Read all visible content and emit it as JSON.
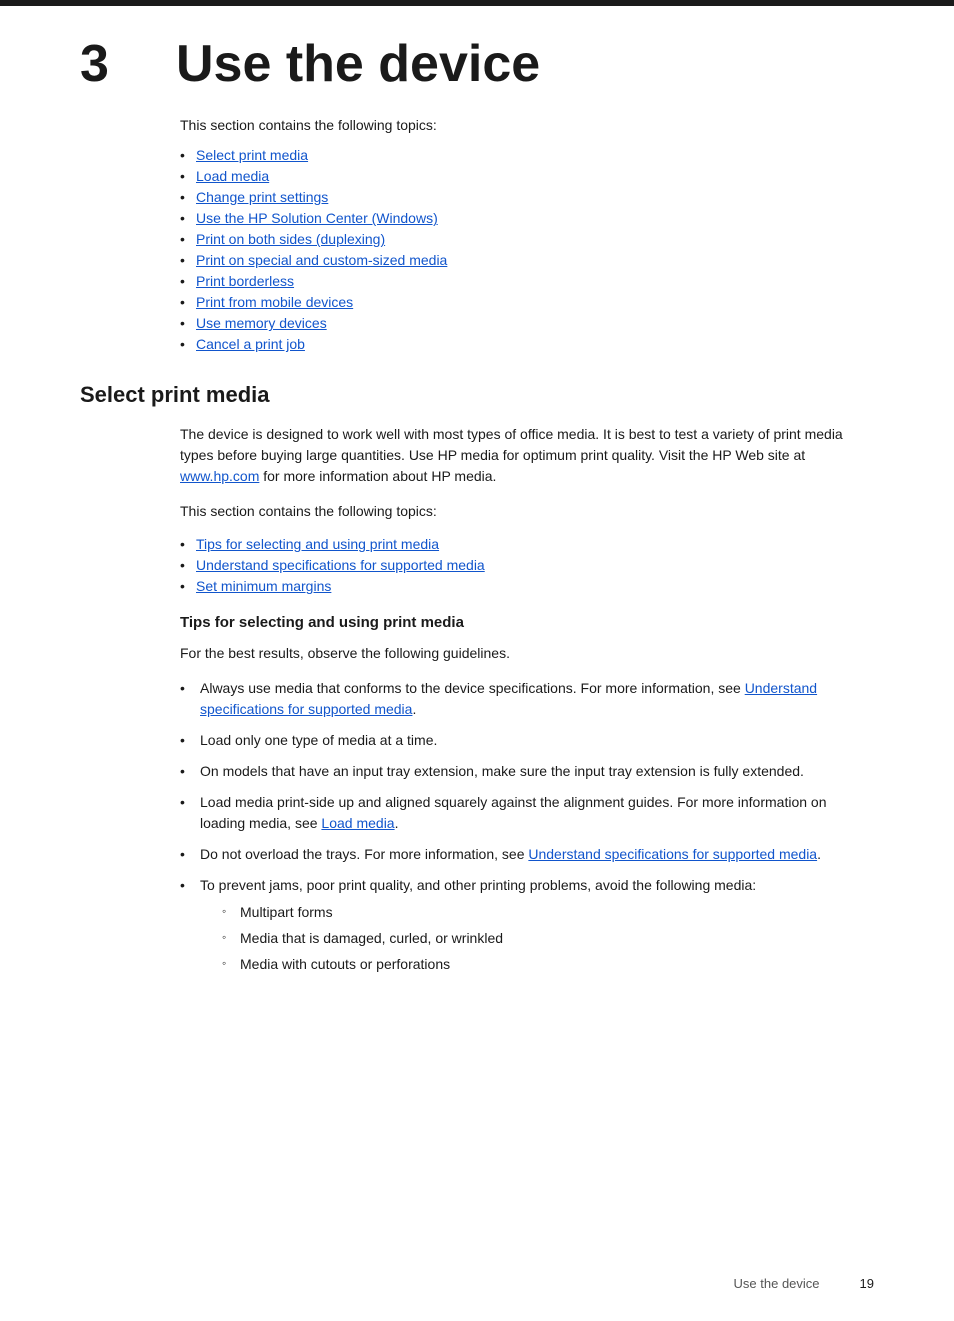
{
  "page": {
    "top_border": true,
    "chapter": {
      "number": "3",
      "title": "Use the device"
    },
    "intro": "This section contains the following topics:",
    "toc_items": [
      {
        "label": "Select print media",
        "href": "#select-print-media"
      },
      {
        "label": "Load media",
        "href": "#load-media"
      },
      {
        "label": "Change print settings",
        "href": "#change-print-settings"
      },
      {
        "label": "Use the HP Solution Center (Windows)",
        "href": "#hp-solution-center"
      },
      {
        "label": "Print on both sides (duplexing)",
        "href": "#duplexing"
      },
      {
        "label": "Print on special and custom-sized media",
        "href": "#special-media"
      },
      {
        "label": "Print borderless",
        "href": "#borderless"
      },
      {
        "label": "Print from mobile devices",
        "href": "#mobile-devices"
      },
      {
        "label": "Use memory devices",
        "href": "#memory-devices"
      },
      {
        "label": "Cancel a print job",
        "href": "#cancel-print"
      }
    ],
    "sections": [
      {
        "id": "select-print-media",
        "title": "Select print media",
        "body": "The device is designed to work well with most types of office media. It is best to test a variety of print media types before buying large quantities. Use HP media for optimum print quality. Visit the HP Web site at ",
        "body_link_text": "www.hp.com",
        "body_link_href": "http://www.hp.com",
        "body_suffix": " for more information about HP media.",
        "subsection_intro": "This section contains the following topics:",
        "sub_toc_items": [
          {
            "label": "Tips for selecting and using print media",
            "href": "#tips"
          },
          {
            "label": "Understand specifications for supported media",
            "href": "#specs"
          },
          {
            "label": "Set minimum margins",
            "href": "#margins"
          }
        ],
        "subsections": [
          {
            "id": "tips",
            "title": "Tips for selecting and using print media",
            "intro": "For the best results, observe the following guidelines.",
            "bullets": [
              {
                "text": "Always use media that conforms to the device specifications. For more information, see ",
                "link_text": "Understand specifications for supported media",
                "link_href": "#specs",
                "text_suffix": ".",
                "sub_bullets": []
              },
              {
                "text": "Load only one type of media at a time.",
                "sub_bullets": []
              },
              {
                "text": "On models that have an input tray extension, make sure the input tray extension is fully extended.",
                "sub_bullets": []
              },
              {
                "text": "Load media print-side up and aligned squarely against the alignment guides. For more information on loading media, see ",
                "link_text": "Load media",
                "link_href": "#load-media",
                "text_suffix": ".",
                "sub_bullets": []
              },
              {
                "text": "Do not overload the trays. For more information, see ",
                "link_text": "Understand specifications for supported media",
                "link_href": "#specs",
                "text_suffix": ".",
                "sub_bullets": []
              },
              {
                "text": "To prevent jams, poor print quality, and other printing problems, avoid the following media:",
                "sub_bullets": [
                  "Multipart forms",
                  "Media that is damaged, curled, or wrinkled",
                  "Media with cutouts or perforations"
                ]
              }
            ]
          }
        ]
      }
    ],
    "footer": {
      "section_label": "Use the device",
      "page_number": "19"
    }
  }
}
